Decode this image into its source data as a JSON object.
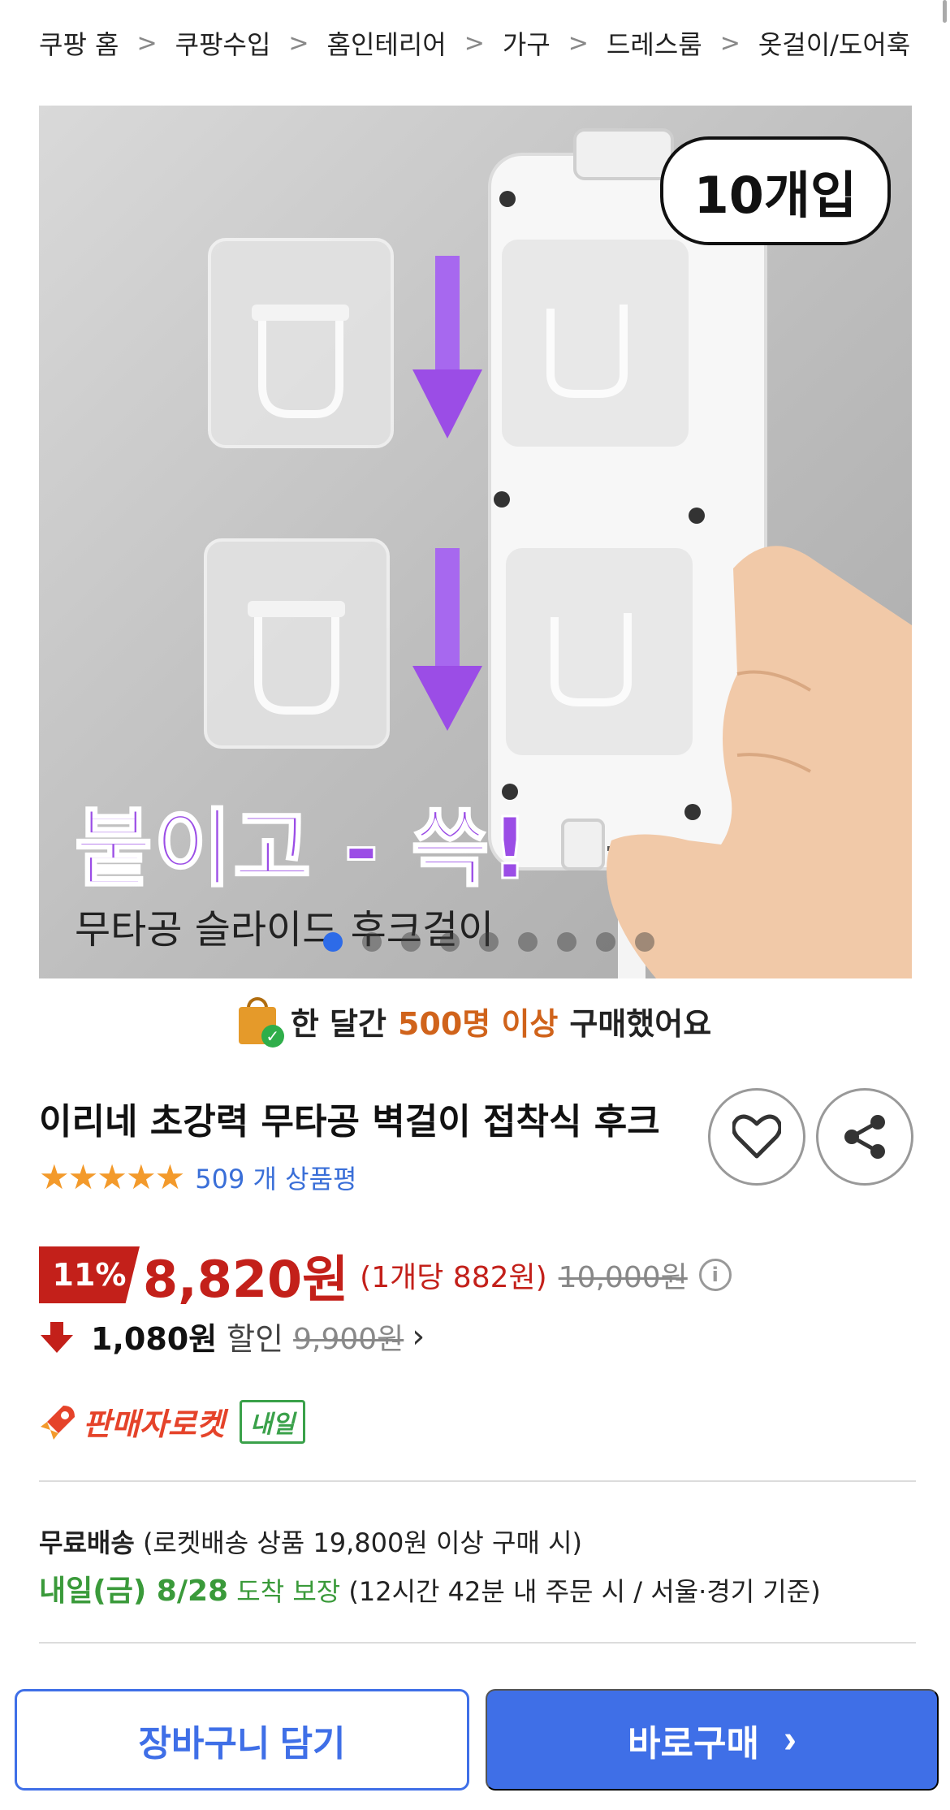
{
  "breadcrumb": [
    "쿠팡 홈",
    "쿠팡수입",
    "홈인테리어",
    "가구",
    "드레스룸",
    "옷걸이/도어훅"
  ],
  "breadcrumb_separator": ">",
  "hero": {
    "badge": "10개입",
    "headline": "붙이고 - 쓱!",
    "subtext": "무타공 슬라이드 후크걸이",
    "slide_count": 9,
    "active_slide": 1
  },
  "social_proof": {
    "prefix": "한 달간",
    "highlight": "500명 이상",
    "suffix": "구매했어요"
  },
  "product": {
    "title": "이리네 초강력 무타공 벽걸이 접착식 후크",
    "stars": "★★★★★",
    "review_count": "509 개 상품평"
  },
  "price": {
    "discount": "11%",
    "sale_price": "8,820원",
    "unit_price": "(1개당 882원)",
    "original_price": "10,000원"
  },
  "coupon": {
    "amount": "1,080원",
    "label": "할인",
    "old_price": "9,900원",
    "chevron": "›"
  },
  "rocket": {
    "logo": "판매자로켓",
    "badge": "내일"
  },
  "shipping": {
    "free_label": "무료배송",
    "free_detail": "(로켓배송 상품 19,800원 이상 구매 시)",
    "arrival_date": "내일(금) 8/28",
    "arrival_guarantee": "도착 보장",
    "arrival_detail": "(12시간 42분 내 주문 시 / 서울·경기 기준)"
  },
  "actions": {
    "cart": "장바구니 담기",
    "buy": "바로구매",
    "buy_chevron": "›"
  },
  "colors": {
    "accent_blue": "#3f6fe7",
    "price_red": "#c3201a",
    "star_orange": "#f39a2b",
    "highlight_orange": "#d0631b",
    "delivery_green": "#3a9a3a"
  }
}
